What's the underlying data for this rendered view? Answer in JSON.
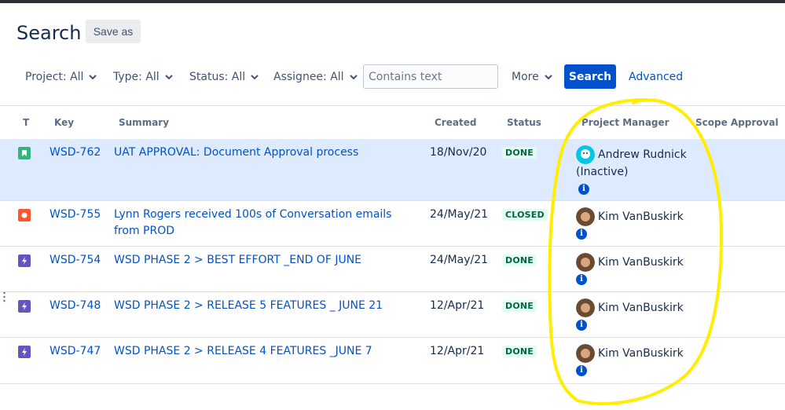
{
  "page": {
    "title": "Search",
    "save_as_label": "Save as"
  },
  "filters": {
    "project": "Project: All",
    "type": "Type: All",
    "status": "Status: All",
    "assignee": "Assignee: All",
    "text_placeholder": "Contains text",
    "more": "More",
    "search_button": "Search",
    "advanced": "Advanced"
  },
  "columns": [
    "T",
    "Key",
    "Summary",
    "Created",
    "Status",
    "Project Manager",
    "Scope Approval"
  ],
  "rows": [
    {
      "type": "story",
      "type_color": "#36b37e",
      "key": "WSD-762",
      "summary": "UAT APPROVAL: Document Approval process",
      "created": "18/Nov/20",
      "status": "DONE",
      "pm": "Andrew Rudnick (Inactive)",
      "selected": true
    },
    {
      "type": "bug",
      "type_color": "#ff5630",
      "key": "WSD-755",
      "summary": "Lynn Rogers received 100s of Conversation emails from PROD",
      "created": "24/May/21",
      "status": "CLOSED",
      "pm": "Kim VanBuskirk"
    },
    {
      "type": "epic",
      "type_color": "#6554c0",
      "key": "WSD-754",
      "summary": "WSD PHASE 2 > BEST EFFORT _END OF JUNE",
      "created": "24/May/21",
      "status": "DONE",
      "pm": "Kim VanBuskirk"
    },
    {
      "type": "epic",
      "type_color": "#6554c0",
      "key": "WSD-748",
      "summary": "WSD PHASE 2 > RELEASE 5 FEATURES _ JUNE 21",
      "created": "12/Apr/21",
      "status": "DONE",
      "pm": "Kim VanBuskirk"
    },
    {
      "type": "epic",
      "type_color": "#6554c0",
      "key": "WSD-747",
      "summary": "WSD PHASE 2 > RELEASE 4 FEATURES _JUNE 7",
      "created": "12/Apr/21",
      "status": "DONE",
      "pm": "Kim VanBuskirk"
    }
  ],
  "colors": {
    "accent": "#0052cc",
    "annotation": "#ffee00"
  },
  "icons": {
    "story": "bookmark-icon",
    "bug": "bug-icon",
    "epic": "lightning-icon",
    "info": "info-icon",
    "chevron": "chevron-down-icon"
  }
}
